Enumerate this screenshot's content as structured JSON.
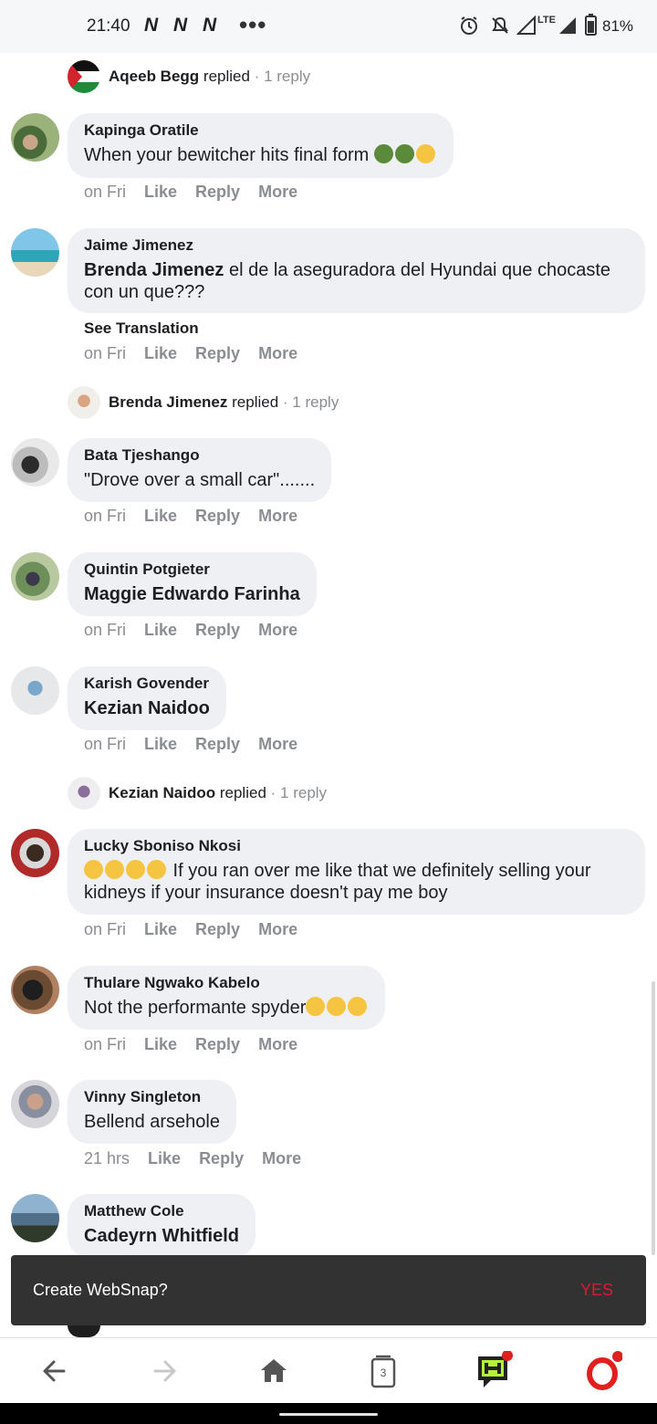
{
  "status_bar": {
    "time": "21:40",
    "notif_letters": [
      "N",
      "N",
      "N"
    ],
    "overflow": "•••",
    "network_label": "LTE",
    "battery": "81%"
  },
  "replies": [
    {
      "name": "Aqeeb Begg",
      "verb": "replied",
      "count": "· 1 reply"
    },
    {
      "name": "Brenda Jimenez",
      "verb": "replied",
      "count": "· 1 reply"
    },
    {
      "name": "Kezian Naidoo",
      "verb": "replied",
      "count": "· 1 reply"
    }
  ],
  "comments": [
    {
      "author": "Kapinga Oratile",
      "text": "When your bewitcher hits final form",
      "time": "on Fri",
      "like": "Like",
      "reply": "Reply",
      "more": "More"
    },
    {
      "author": "Jaime Jimenez",
      "mention": "Brenda Jimenez",
      "text": " el de la aseguradora del Hyundai que chocaste con un que???",
      "see_translation": "See Translation",
      "time": "on Fri",
      "like": "Like",
      "reply": "Reply",
      "more": "More"
    },
    {
      "author": "Bata Tjeshango",
      "text": "\"Drove over a small car\".......",
      "time": "on Fri",
      "like": "Like",
      "reply": "Reply",
      "more": "More"
    },
    {
      "author": "Quintin Potgieter",
      "mention": "Maggie Edwardo Farinha",
      "time": "on Fri",
      "like": "Like",
      "reply": "Reply",
      "more": "More"
    },
    {
      "author": "Karish Govender",
      "mention": "Kezian Naidoo",
      "time": "on Fri",
      "like": "Like",
      "reply": "Reply",
      "more": "More"
    },
    {
      "author": "Lucky Sboniso Nkosi",
      "text": " If you ran over me like that we definitely selling your kidneys if your insurance doesn't pay me boy",
      "time": "on Fri",
      "like": "Like",
      "reply": "Reply",
      "more": "More"
    },
    {
      "author": "Thulare Ngwako Kabelo",
      "text": "Not the performante spyder",
      "time": "on Fri",
      "like": "Like",
      "reply": "Reply",
      "more": "More"
    },
    {
      "author": "Vinny Singleton",
      "text": "Bellend arsehole",
      "time": "21 hrs",
      "like": "Like",
      "reply": "Reply",
      "more": "More"
    },
    {
      "author": "Matthew Cole",
      "mention": "Cadeyrn Whitfield"
    }
  ],
  "snackbar": {
    "text": "Create WebSnap?",
    "action": "YES"
  },
  "bottom_nav": {
    "tab_count": "3",
    "icons": [
      "back-arrow-icon",
      "forward-arrow-icon",
      "home-icon",
      "tabs-icon",
      "hype-icon",
      "opera-icon"
    ]
  },
  "colors": {
    "bubble": "#eef0f3",
    "muted": "#8a8d91",
    "snack_bg": "#323232",
    "snack_action": "#d81b32",
    "opera_red": "#e0201f"
  }
}
